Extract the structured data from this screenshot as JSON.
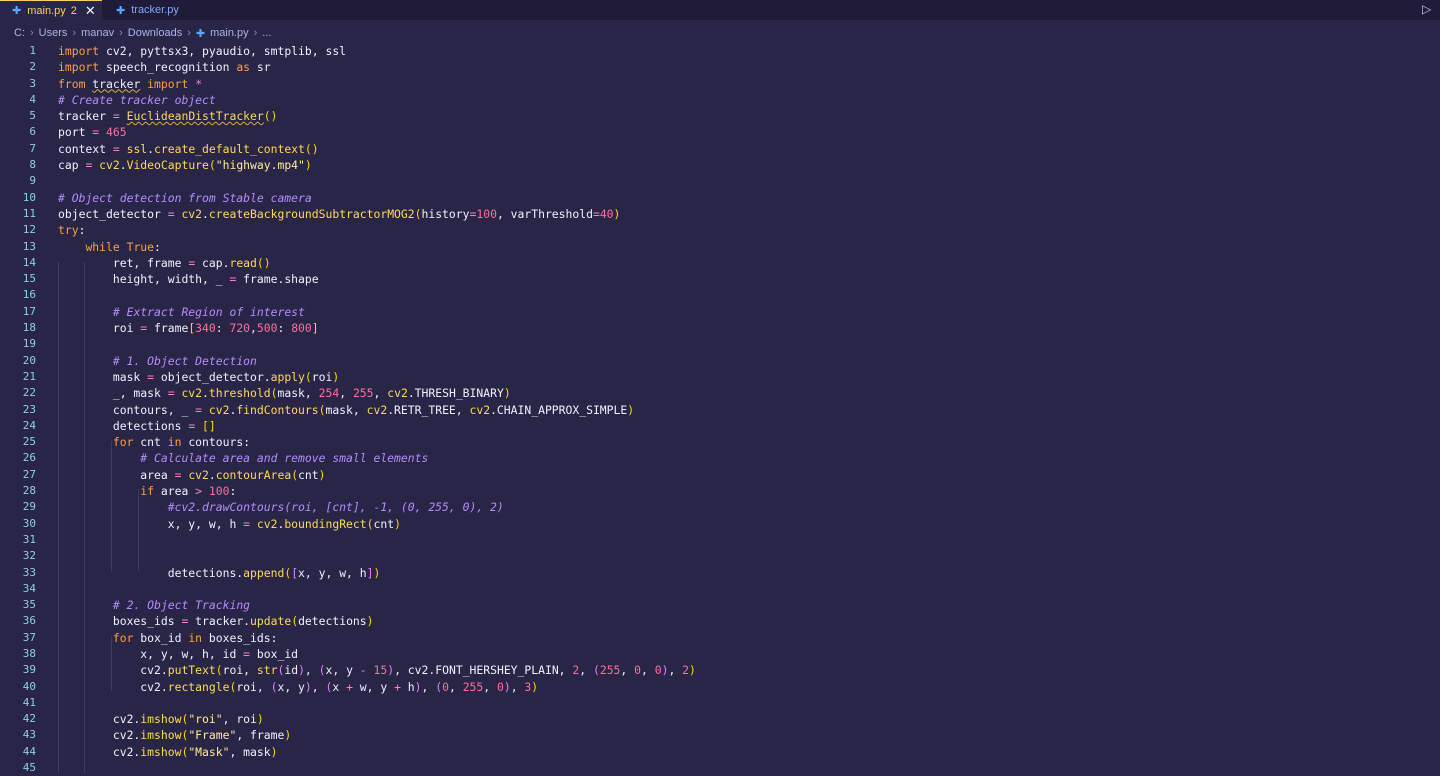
{
  "tabs": [
    {
      "label": "main.py",
      "badge": "2",
      "active": true
    },
    {
      "label": "tracker.py",
      "active": false
    }
  ],
  "breadcrumb": [
    "C:",
    "Users",
    "manav",
    "Downloads",
    "main.py",
    "..."
  ],
  "colors": {
    "background": "#292547",
    "keyword": "#ff9f40",
    "function": "#ffd95a",
    "number": "#ff6e9c",
    "string": "#ffe99a",
    "comment": "#b58cff"
  },
  "editor": {
    "lines": [
      "import cv2, pyttsx3, pyaudio, smtplib, ssl",
      "import speech_recognition as sr",
      "from tracker import *",
      "# Create tracker object",
      "tracker = EuclideanDistTracker()",
      "port = 465",
      "context = ssl.create_default_context()",
      "cap = cv2.VideoCapture(\"highway.mp4\")",
      "",
      "# Object detection from Stable camera",
      "object_detector = cv2.createBackgroundSubtractorMOG2(history=100, varThreshold=40)",
      "try:",
      "    while True:",
      "        ret, frame = cap.read()",
      "        height, width, _ = frame.shape",
      "",
      "        # Extract Region of interest",
      "        roi = frame[340: 720,500: 800]",
      "",
      "        # 1. Object Detection",
      "        mask = object_detector.apply(roi)",
      "        _, mask = cv2.threshold(mask, 254, 255, cv2.THRESH_BINARY)",
      "        contours, _ = cv2.findContours(mask, cv2.RETR_TREE, cv2.CHAIN_APPROX_SIMPLE)",
      "        detections = []",
      "        for cnt in contours:",
      "            # Calculate area and remove small elements",
      "            area = cv2.contourArea(cnt)",
      "            if area > 100:",
      "                #cv2.drawContours(roi, [cnt], -1, (0, 255, 0), 2)",
      "                x, y, w, h = cv2.boundingRect(cnt)",
      "",
      "",
      "                detections.append([x, y, w, h])",
      "",
      "        # 2. Object Tracking",
      "        boxes_ids = tracker.update(detections)",
      "        for box_id in boxes_ids:",
      "            x, y, w, h, id = box_id",
      "            cv2.putText(roi, str(id), (x, y - 15), cv2.FONT_HERSHEY_PLAIN, 2, (255, 0, 0), 2)",
      "            cv2.rectangle(roi, (x, y), (x + w, y + h), (0, 255, 0), 3)",
      "",
      "        cv2.imshow(\"roi\", roi)",
      "        cv2.imshow(\"Frame\", frame)",
      "        cv2.imshow(\"Mask\", mask)",
      ""
    ]
  }
}
